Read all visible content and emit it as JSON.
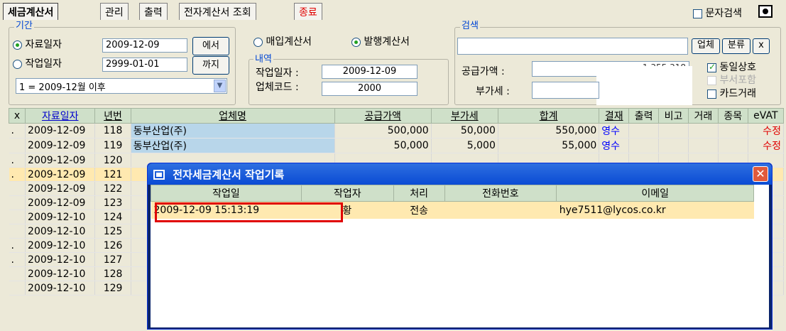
{
  "tabs": [
    "세금계산서",
    "관리",
    "출력",
    "전자계산서 조회",
    "종료"
  ],
  "top_right": {
    "text_search_label": "문자검색"
  },
  "period": {
    "group_label": "기간",
    "radio1_label": "자료일자",
    "radio2_label": "작업일자",
    "date1": "2009-12-09",
    "date2": "2999-01-01",
    "btn_from": "에서",
    "btn_to": "까지",
    "month_select": "1 = 2009-12월 이후"
  },
  "type": {
    "purchase_label": "매입계산서",
    "issue_label": "발행계산서"
  },
  "detail": {
    "group_label": "내역",
    "workdate_label": "작업일자 :",
    "workdate_value": "2009-12-09",
    "code_label": "업체코드 :",
    "code_value": "2000"
  },
  "search": {
    "group_label": "검색",
    "btn_company": "업체",
    "btn_category": "분류",
    "btn_close": "x",
    "supply_label": "공급가액 :",
    "supply_value": "1,355,318",
    "vat_label": "부가세 :",
    "same_company_label": "동일상호",
    "dept_label": "부서포함",
    "card_label": "카드거래"
  },
  "grid": {
    "headers": [
      "x",
      "자료일자",
      "년번",
      "업체명",
      "공급가액",
      "부가세",
      "합계",
      "결재",
      "출력",
      "비고",
      "거래",
      "종목",
      "eVAT"
    ],
    "rows": [
      {
        "mark": ".",
        "date": "2009-12-09",
        "no": "118",
        "company": "동부산업(주)",
        "supply": "500,000",
        "vat": "50,000",
        "total": "550,000",
        "pay": "영수",
        "evat": "수정"
      },
      {
        "mark": "",
        "date": "2009-12-09",
        "no": "119",
        "company": "동부산업(주)",
        "supply": "50,000",
        "vat": "5,000",
        "total": "55,000",
        "pay": "영수",
        "evat": "수정"
      },
      {
        "mark": ".",
        "date": "2009-12-09",
        "no": "120",
        "company": "",
        "supply": "",
        "vat": "",
        "total": "",
        "pay": "",
        "evat": ""
      },
      {
        "mark": ".",
        "date": "2009-12-09",
        "no": "121",
        "company": "",
        "supply": "",
        "vat": "",
        "total": "",
        "pay": "",
        "evat": ""
      },
      {
        "mark": "",
        "date": "2009-12-09",
        "no": "122",
        "company": "",
        "supply": "",
        "vat": "",
        "total": "",
        "pay": "",
        "evat": ""
      },
      {
        "mark": "",
        "date": "2009-12-09",
        "no": "123",
        "company": "",
        "supply": "",
        "vat": "",
        "total": "",
        "pay": "",
        "evat": ""
      },
      {
        "mark": "",
        "date": "2009-12-10",
        "no": "124",
        "company": "",
        "supply": "",
        "vat": "",
        "total": "",
        "pay": "",
        "evat": ""
      },
      {
        "mark": "",
        "date": "2009-12-10",
        "no": "125",
        "company": "",
        "supply": "",
        "vat": "",
        "total": "",
        "pay": "",
        "evat": ""
      },
      {
        "mark": ".",
        "date": "2009-12-10",
        "no": "126",
        "company": "",
        "supply": "",
        "vat": "",
        "total": "",
        "pay": "",
        "evat": ""
      },
      {
        "mark": ".",
        "date": "2009-12-10",
        "no": "127",
        "company": "",
        "supply": "",
        "vat": "",
        "total": "",
        "pay": "",
        "evat": ""
      },
      {
        "mark": "",
        "date": "2009-12-10",
        "no": "128",
        "company": "",
        "supply": "",
        "vat": "",
        "total": "",
        "pay": "",
        "evat": ""
      },
      {
        "mark": "",
        "date": "2009-12-10",
        "no": "129",
        "company": "",
        "supply": "",
        "vat": "",
        "total": "",
        "pay": "",
        "evat": ""
      }
    ]
  },
  "modal": {
    "title": "전자세금계산서 작업기록",
    "headers": [
      "작업일",
      "작업자",
      "처리",
      "전화번호",
      "이메일"
    ],
    "row": {
      "datetime": "2009-12-09 15:13:19",
      "worker": "황",
      "action": "전송",
      "phone": "",
      "email": "hye7511@lycos.co.kr"
    }
  },
  "colors": {
    "highlight": "#e00000",
    "blue_text": "#0000ff",
    "selected_row": "#ffe9b0",
    "header_bg": "#cfe0c9"
  }
}
